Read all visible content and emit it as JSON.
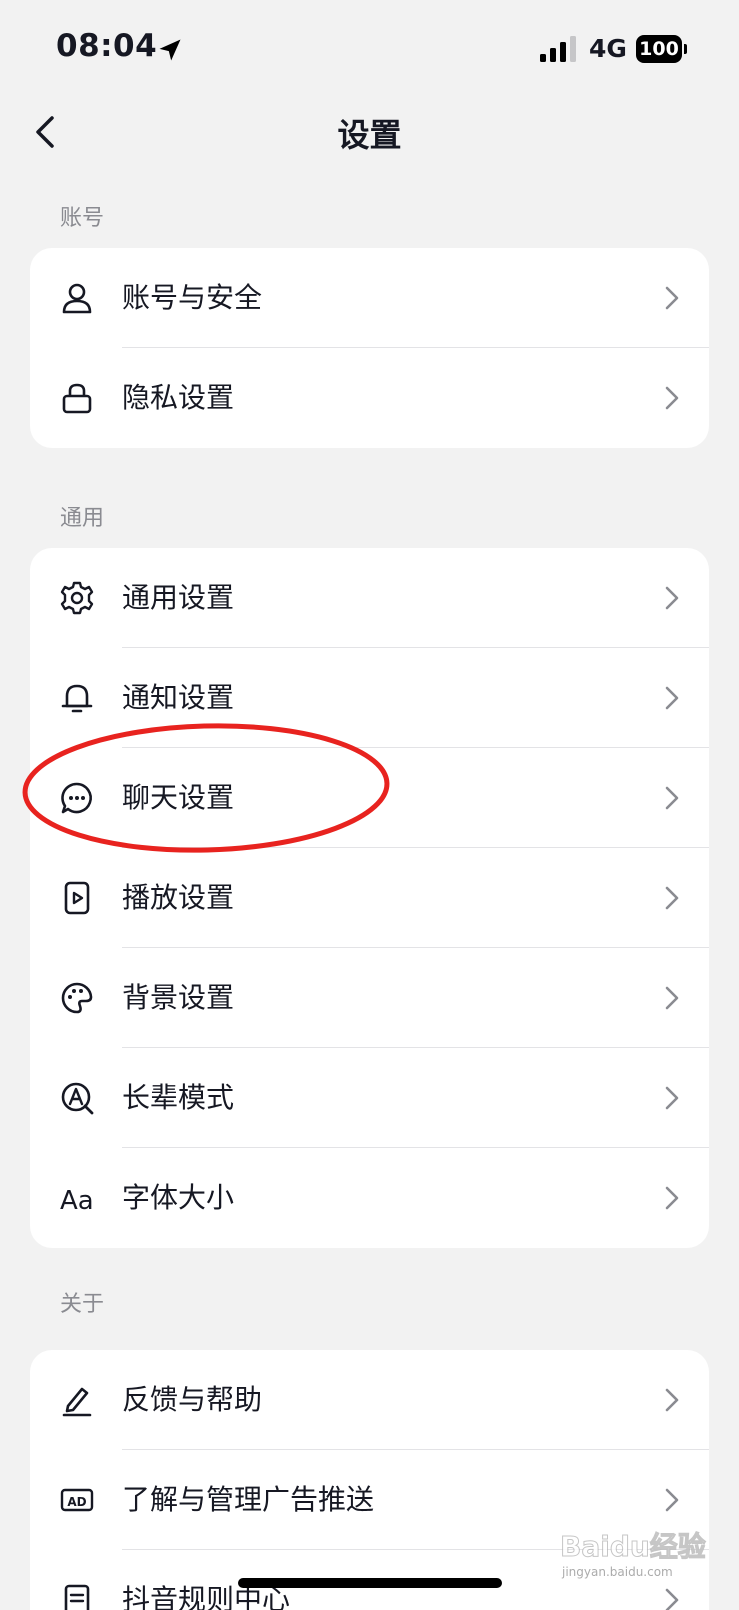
{
  "status_bar": {
    "time": "08:04",
    "network": "4G",
    "battery": "100"
  },
  "nav": {
    "title": "设置"
  },
  "sections": [
    {
      "header": "账号",
      "items": [
        {
          "label": "账号与安全",
          "icon": "user-icon"
        },
        {
          "label": "隐私设置",
          "icon": "lock-icon"
        }
      ]
    },
    {
      "header": "通用",
      "items": [
        {
          "label": "通用设置",
          "icon": "gear-icon"
        },
        {
          "label": "通知设置",
          "icon": "bell-icon"
        },
        {
          "label": "聊天设置",
          "icon": "chat-bubble-icon"
        },
        {
          "label": "播放设置",
          "icon": "play-icon"
        },
        {
          "label": "背景设置",
          "icon": "palette-icon"
        },
        {
          "label": "长辈模式",
          "icon": "elder-mode-icon"
        },
        {
          "label": "字体大小",
          "icon": "font-size-icon",
          "icon_text": "Aa"
        }
      ]
    },
    {
      "header": "关于",
      "items": [
        {
          "label": "反馈与帮助",
          "icon": "edit-icon"
        },
        {
          "label": "了解与管理广告推送",
          "icon": "ad-icon",
          "icon_text": "AD"
        },
        {
          "label": "抖音规则中心",
          "icon": "document-icon"
        }
      ]
    }
  ],
  "highlight": {
    "color": "#e8231f",
    "target": "聊天设置"
  },
  "watermark": {
    "text": "Baidu经验",
    "subtext": "jingyan.baidu.com"
  },
  "colors": {
    "background": "#f2f2f2",
    "card": "#ffffff",
    "text": "#161823",
    "secondary": "#8a8b91",
    "divider": "#e3e3e6"
  }
}
